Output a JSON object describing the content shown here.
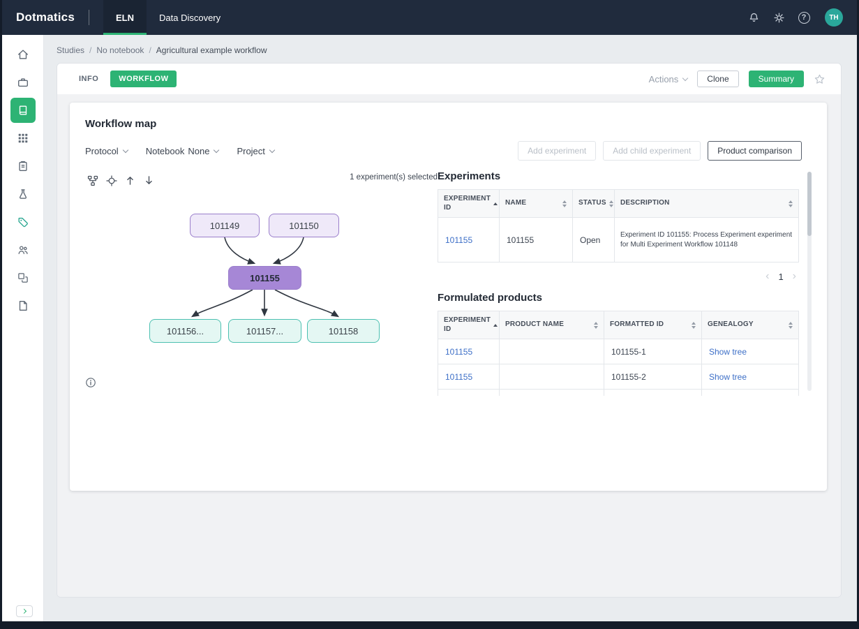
{
  "topbar": {
    "logo": "Dotmatics",
    "nav": [
      {
        "label": "ELN",
        "active": true
      },
      {
        "label": "Data Discovery",
        "active": false
      }
    ],
    "avatar": "TH",
    "icons": [
      "bell-icon",
      "gear-icon",
      "help-icon"
    ]
  },
  "sidebar": {
    "icons": [
      "home-icon",
      "briefcase-icon",
      "notebook-icon",
      "grid-icon",
      "clipboard-icon",
      "flask-icon",
      "tag-icon",
      "users-icon",
      "layers-icon",
      "document-icon"
    ],
    "active_icon": "notebook-icon"
  },
  "breadcrumb": {
    "items": [
      "Studies",
      "No notebook",
      "Agricultural example workflow"
    ],
    "separator": "/"
  },
  "header": {
    "tabs": [
      {
        "label": "INFO",
        "active": false
      },
      {
        "label": "WORKFLOW",
        "active": true
      }
    ],
    "actions_label": "Actions",
    "clone_label": "Clone",
    "summary_label": "Summary"
  },
  "workflow": {
    "title": "Workflow map",
    "protocol_label": "Protocol",
    "notebook_label": "Notebook",
    "notebook_value": "None",
    "project_label": "Project",
    "add_experiment_label": "Add experiment",
    "add_child_experiment_label": "Add child experiment",
    "product_comparison_label": "Product comparison",
    "selected_text": "1 experiment(s) selected",
    "nodes": [
      {
        "label": "101149",
        "style": "purple"
      },
      {
        "label": "101150",
        "style": "purple"
      },
      {
        "label": "101155",
        "style": "selected"
      },
      {
        "label": "101156...",
        "style": "teal"
      },
      {
        "label": "101157...",
        "style": "teal"
      },
      {
        "label": "101158",
        "style": "teal"
      }
    ],
    "edges": [
      [
        "101149",
        "101155"
      ],
      [
        "101150",
        "101155"
      ],
      [
        "101155",
        "101156..."
      ],
      [
        "101155",
        "101157..."
      ],
      [
        "101155",
        "101158"
      ]
    ]
  },
  "experiments": {
    "title": "Experiments",
    "columns": [
      "EXPERIMENT ID",
      "NAME",
      "STATUS",
      "DESCRIPTION"
    ],
    "sorted_column": "EXPERIMENT ID",
    "rows": [
      {
        "experiment_id": "101155",
        "name": "101155",
        "status": "Open",
        "description": "Experiment ID 101155: Process Experiment experiment for Multi Experiment Workflow 101148"
      }
    ],
    "page": "1"
  },
  "formulated_products": {
    "title": "Formulated products",
    "columns": [
      "EXPERIMENT ID",
      "PRODUCT NAME",
      "FORMATTED ID",
      "GENEALOGY"
    ],
    "rows": [
      {
        "experiment_id": "101155",
        "product_name": "",
        "formatted_id": "101155-1",
        "genealogy_link": "Show tree"
      },
      {
        "experiment_id": "101155",
        "product_name": "",
        "formatted_id": "101155-2",
        "genealogy_link": "Show tree"
      }
    ]
  },
  "colors": {
    "accent_green": "#2db374",
    "topbar_bg": "#202b3d",
    "link_blue": "#3d6fc7",
    "node_purple_fill": "#efe9f9",
    "node_purple_border": "#9a7ecb",
    "node_selected_fill": "#a687d6",
    "node_teal_fill": "#e4f7f3",
    "node_teal_border": "#4cc0b0",
    "avatar_teal": "#2aa79b"
  }
}
